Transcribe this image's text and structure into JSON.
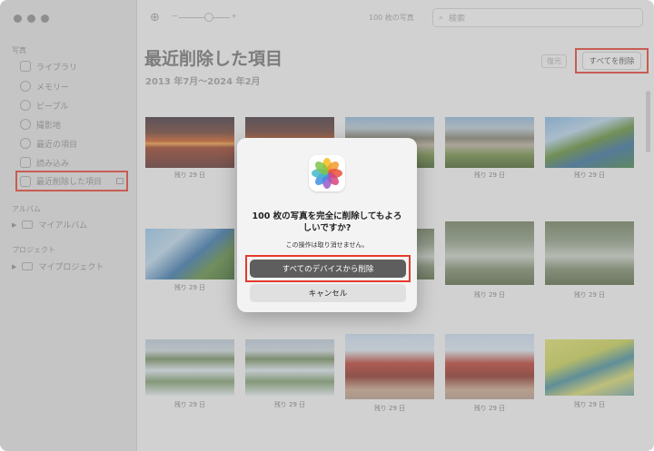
{
  "sidebar": {
    "sections": {
      "photos": "写真",
      "albums": "アルバム",
      "projects": "プロジェクト"
    },
    "items": [
      {
        "label": "ライブラリ",
        "icon": "library-icon"
      },
      {
        "label": "メモリー",
        "icon": "memories-icon"
      },
      {
        "label": "ピープル",
        "icon": "people-icon"
      },
      {
        "label": "撮影地",
        "icon": "places-icon"
      },
      {
        "label": "最近の項目",
        "icon": "recents-icon"
      },
      {
        "label": "読み込み",
        "icon": "imports-icon"
      },
      {
        "label": "最近削除した項目",
        "icon": "trash-icon",
        "selected": true
      }
    ],
    "groups": {
      "my_albums": "マイアルバム",
      "my_projects": "マイプロジェクト"
    }
  },
  "toolbar": {
    "count": "100 枚の写真",
    "search_placeholder": "検索"
  },
  "main": {
    "title": "最近削除した項目",
    "subtitle": "2013 年7月〜2024 年2月",
    "restore_label": "復元",
    "delete_all_label": "すべてを削除",
    "caption": "残り 29 日"
  },
  "dialog": {
    "message": "100 枚の写真を完全に削除してもよろしいですか?",
    "submessage": "この操作は取り消せません。",
    "primary_label": "すべてのデバイスから削除",
    "cancel_label": "キャンセル"
  },
  "colors": {
    "highlight": "#e53a2d"
  }
}
